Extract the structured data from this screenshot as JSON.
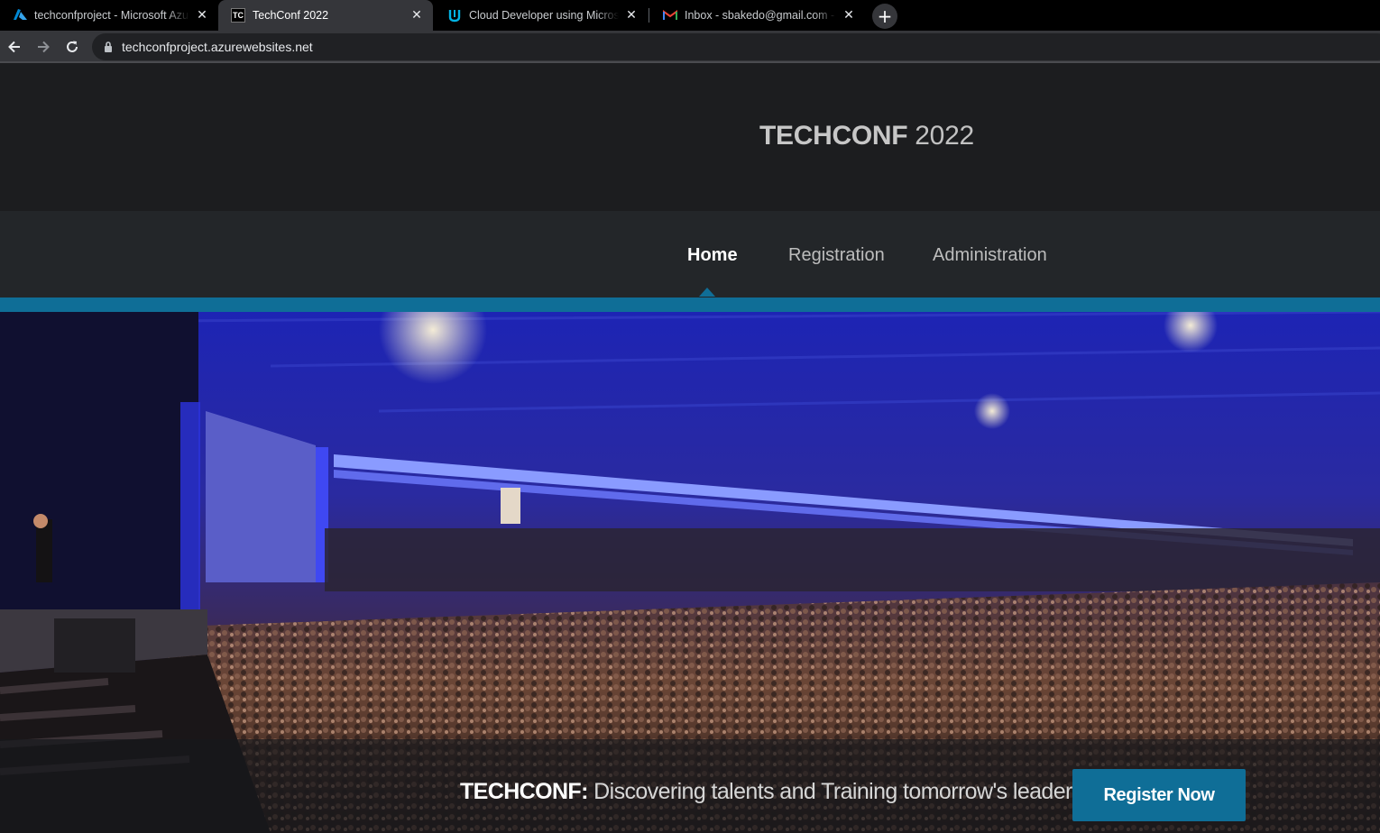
{
  "browser": {
    "tabs": [
      {
        "title": "techconfproject - Microsoft Azure",
        "icon": "azure-icon",
        "active": false
      },
      {
        "title": "TechConf 2022",
        "icon": "tc-icon",
        "active": true
      },
      {
        "title": "Cloud Developer using Microsoft Azure",
        "icon": "udacity-icon",
        "active": false
      },
      {
        "title": "Inbox - sbakedo@gmail.com - Gmail",
        "icon": "gmail-icon",
        "active": false
      }
    ],
    "tc_favicon_text": "TC",
    "url": "techconfproject.azurewebsites.net"
  },
  "site": {
    "brand_strong": "TECHCONF",
    "brand_light": " 2022",
    "nav": [
      {
        "label": "Home",
        "active": true
      },
      {
        "label": "Registration",
        "active": false
      },
      {
        "label": "Administration",
        "active": false
      }
    ],
    "hero": {
      "tagline_strong": "TECHCONF:",
      "tagline_rest": " Discovering talents and Training tomorrow's leaders",
      "cta_label": "Register Now"
    }
  },
  "colors": {
    "accent": "#0f6e97",
    "header_bg": "#1c1d1f",
    "nav_bg": "#232629"
  }
}
